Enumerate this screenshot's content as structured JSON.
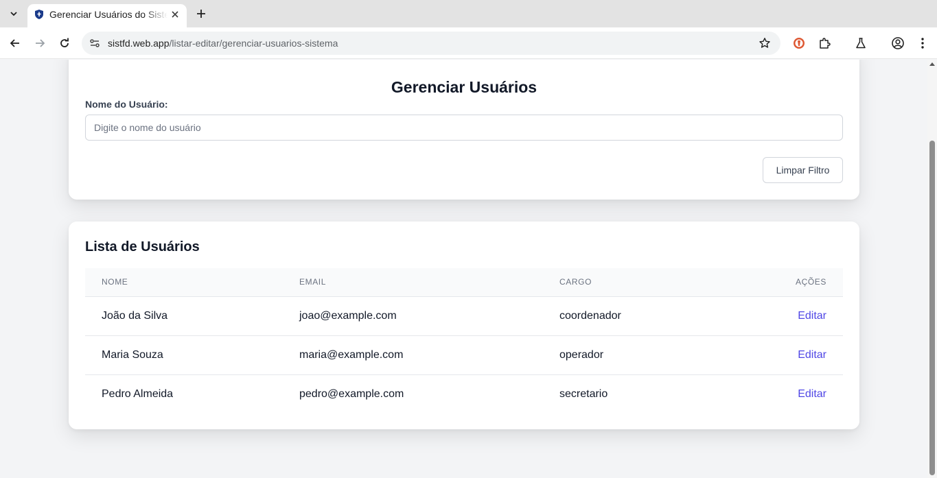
{
  "browser": {
    "tab_title": "Gerenciar Usuários do Sistema",
    "url_host": "sistfd.web.app",
    "url_path": "/listar-editar/gerenciar-usuarios-sistema"
  },
  "filter": {
    "title": "Gerenciar Usuários",
    "name_label": "Nome do Usuário:",
    "name_placeholder": "Digite o nome do usuário",
    "name_value": "",
    "clear_button": "Limpar Filtro"
  },
  "list": {
    "title": "Lista de Usuários",
    "columns": [
      "NOME",
      "EMAIL",
      "CARGO",
      "AÇÕES"
    ],
    "rows": [
      {
        "nome": "João da Silva",
        "email": "joao@example.com",
        "cargo": "coordenador",
        "action": "Editar"
      },
      {
        "nome": "Maria Souza",
        "email": "maria@example.com",
        "cargo": "operador",
        "action": "Editar"
      },
      {
        "nome": "Pedro Almeida",
        "email": "pedro@example.com",
        "cargo": "secretario",
        "action": "Editar"
      }
    ]
  },
  "colors": {
    "accent": "#4f46e5",
    "page_bg": "#f3f4f6",
    "favicon": "#1a3a8a"
  },
  "icons": [
    "tab-search-icon",
    "shield-favicon-icon",
    "close-icon",
    "plus-icon",
    "back-arrow-icon",
    "forward-arrow-icon",
    "reload-icon",
    "site-settings-icon",
    "star-icon",
    "duckduckgo-icon",
    "extensions-icon",
    "labs-flask-icon",
    "profile-icon",
    "more-vertical-icon"
  ]
}
